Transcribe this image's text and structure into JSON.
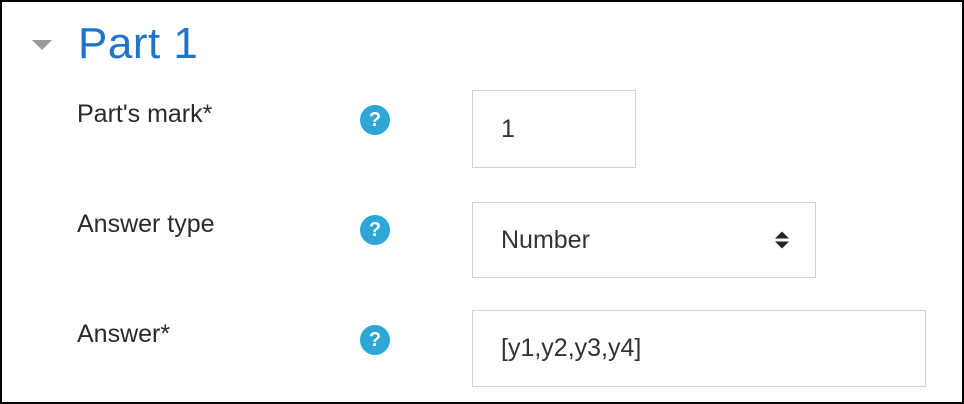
{
  "section": {
    "title": "Part 1",
    "toggle_icon": "chevron-down-icon"
  },
  "fields": {
    "parts_mark": {
      "label": "Part's mark*",
      "help_icon": "question-circle-icon",
      "help_glyph": "?",
      "value": "1"
    },
    "answer_type": {
      "label": "Answer type",
      "help_icon": "question-circle-icon",
      "help_glyph": "?",
      "selected": "Number",
      "arrow_icon": "sort-updown-icon"
    },
    "answer": {
      "label": "Answer*",
      "help_icon": "question-circle-icon",
      "help_glyph": "?",
      "value": "[y1,y2,y3,y4]"
    }
  },
  "colors": {
    "title": "#1f73c9",
    "help_icon": "#2ea6d6",
    "field_border": "#cfd3d7",
    "frame_border": "#000000",
    "chevron": "#9a9a9a"
  }
}
